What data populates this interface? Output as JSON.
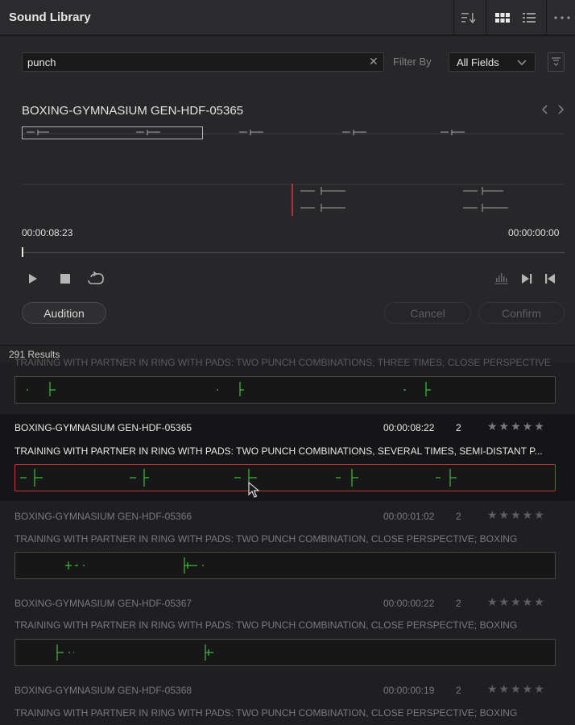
{
  "window": {
    "title": "Sound Library"
  },
  "header": {
    "icons": [
      "sort-icon",
      "grid-view-icon",
      "list-view-icon",
      "more-icon"
    ]
  },
  "search": {
    "value": "punch",
    "clear_icon": "✕"
  },
  "filter": {
    "label": "Filter By",
    "selected": "All Fields",
    "options_icon": "filter-icon"
  },
  "preview": {
    "clip_name": "BOXING-GYMNASIUM GEN-HDF-05365",
    "timecode_current": "00:00:08:23",
    "timecode_end": "00:00:00:00",
    "playhead_progress": 0
  },
  "transport": {
    "play_icon": "play-icon",
    "stop_icon": "stop-icon",
    "loop_icon": "loop-icon",
    "audio_icon": "audio-meter-icon",
    "next_icon": "next-clip-icon",
    "prev_icon": "prev-clip-icon"
  },
  "buttons": {
    "audition": "Audition",
    "cancel": "Cancel",
    "confirm": "Confirm"
  },
  "results": {
    "count_label": "291 Results",
    "partial_desc": "TRAINING WITH PARTNER IN RING WITH PADS: TWO PUNCH COMBINATIONS, THREE TIMES, CLOSE PERSPECTIVE",
    "items": [
      {
        "name": "BOXING-GYMNASIUM GEN-HDF-05365",
        "duration": "00:00:08:22",
        "channels": "2",
        "rating": 0,
        "description": "TRAINING WITH PARTNER IN RING WITH PADS: TWO PUNCH COMBINATIONS, SEVERAL TIMES, SEMI-DISTANT P...",
        "selected": true
      },
      {
        "name": "BOXING-GYMNASIUM GEN-HDF-05366",
        "duration": "00:00:01:02",
        "channels": "2",
        "rating": 0,
        "description": "TRAINING WITH PARTNER IN RING WITH PADS: TWO PUNCH COMBINATION, CLOSE PERSPECTIVE; BOXING",
        "selected": false
      },
      {
        "name": "BOXING-GYMNASIUM GEN-HDF-05367",
        "duration": "00:00:00:22",
        "channels": "2",
        "rating": 0,
        "description": "TRAINING WITH PARTNER IN RING WITH PADS: TWO PUNCH COMBINATION, CLOSE PERSPECTIVE; BOXING",
        "selected": false
      },
      {
        "name": "BOXING-GYMNASIUM GEN-HDF-05368",
        "duration": "00:00:00:19",
        "channels": "2",
        "rating": 0,
        "description": "TRAINING WITH PARTNER IN RING WITH PADS: TWO PUNCH COMBINATION, CLOSE PERSPECTIVE; BOXING",
        "selected": false
      }
    ]
  },
  "colors": {
    "accent_red": "#c23838",
    "waveform_green": "#3bbf3b",
    "waveform_grey": "#9a9a9a"
  }
}
